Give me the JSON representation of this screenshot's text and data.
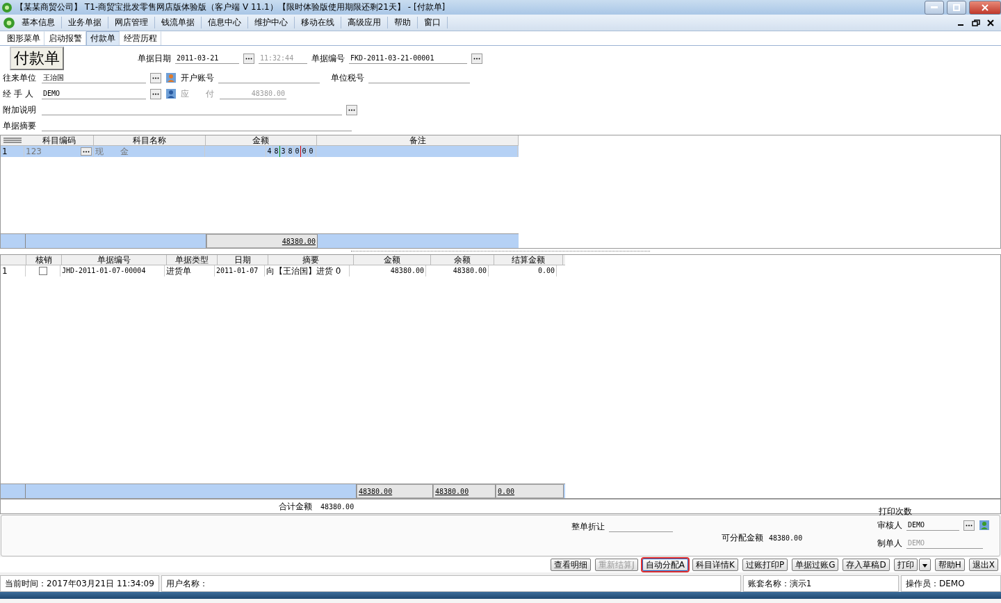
{
  "window": {
    "title": "【某某商贸公司】 T1-商贸宝批发零售网店版体验版（客户端 V 11.1）【限时体验版使用期限还剩21天】 - [付款单]"
  },
  "menu": [
    "基本信息",
    "业务单据",
    "网店管理",
    "钱流单据",
    "信息中心",
    "维护中心",
    "移动在线",
    "高级应用",
    "帮助",
    "窗口"
  ],
  "tabs": [
    {
      "label": "图形菜单",
      "selected": false
    },
    {
      "label": "启动报警",
      "selected": false
    },
    {
      "label": "付款单",
      "selected": true
    },
    {
      "label": "经营历程",
      "selected": false
    }
  ],
  "form": {
    "title": "付款单",
    "date_label": "单据日期",
    "date": "2011-03-21",
    "time": "11:32:44",
    "number_label": "单据编号",
    "number": "FKD-2011-03-21-00001",
    "partner_label": "往来单位",
    "partner": "王治国",
    "account_label": "开户账号",
    "tax_label": "单位税号",
    "handler_label": "经 手 人",
    "handler": "DEMO",
    "payable_label": "应　　付",
    "payable": "48380.00",
    "note_label": "附加说明",
    "summary_label": "单据摘要"
  },
  "subject_table": {
    "columns": [
      "科目编码",
      "科目名称",
      "金额",
      "备注"
    ],
    "rows": [
      {
        "no": "1",
        "code": "123",
        "name": "现　　金",
        "amount_digits": [
          "4",
          "8",
          "3",
          "8",
          "0",
          "0",
          "0"
        ],
        "selected": true
      }
    ],
    "total": "48380.00"
  },
  "bill_table": {
    "columns": [
      "核销",
      "单据编号",
      "单据类型",
      "日期",
      "摘要",
      "金额",
      "余额",
      "结算金额"
    ],
    "rows": [
      {
        "no": "1",
        "checked": false,
        "number": "JHD-2011-01-07-00004",
        "type": "进货单",
        "date": "2011-01-07",
        "summary": "向【王治国】进货 0",
        "amount": "48380.00",
        "balance": "48380.00",
        "settled": "0.00"
      }
    ],
    "totals": [
      "48380.00",
      "48380.00",
      "0.00"
    ]
  },
  "summary": {
    "total_label": "合计金额",
    "total": "48380.00",
    "print_label": "打印次数",
    "discount_label": "整单折让",
    "allocatable_label": "可分配金额",
    "allocatable": "48380.00",
    "reviewer_label": "审核人",
    "reviewer": "DEMO",
    "maker_label": "制单人",
    "maker": "DEMO"
  },
  "buttons": [
    {
      "label": "查看明细",
      "disabled": false
    },
    {
      "label": "重新结算J",
      "disabled": true
    },
    {
      "label": "自动分配A",
      "disabled": false,
      "focused": true
    },
    {
      "label": "科目详情K",
      "disabled": false
    },
    {
      "label": "过账打印P",
      "disabled": false
    },
    {
      "label": "单据过账G",
      "disabled": false
    },
    {
      "label": "存入草稿D",
      "disabled": false
    },
    {
      "label": "打印",
      "disabled": false,
      "kind": "split"
    },
    {
      "label": "帮助H",
      "disabled": false
    },
    {
      "label": "退出X",
      "disabled": false
    }
  ],
  "status_bar": {
    "time": "当前时间：2017年03月21日 11:34:09",
    "user": "用户名称：",
    "book": "账套名称：演示1",
    "operator": "操作员：DEMO"
  }
}
